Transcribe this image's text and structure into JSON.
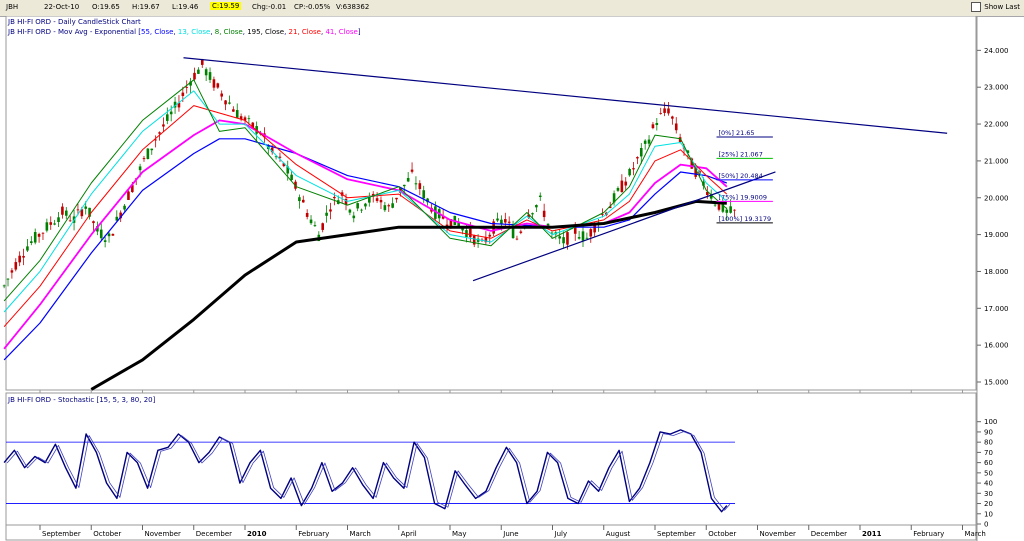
{
  "toolbar": {
    "symbol": "JBH",
    "date": "22-Oct-10",
    "open": "O:19.65",
    "high": "H:19.67",
    "low": "L:19.46",
    "close": "C:19.59",
    "change": "Chg:-0.01",
    "change_pct": "CP:-0.05%",
    "volume": "V:638362",
    "show_last": "Show Last"
  },
  "colors": {
    "ema55": "#0000ff",
    "ema13": "#00e0e0",
    "ema8": "#008000",
    "ema195": "#000000",
    "ema21": "#ff0000",
    "ema41": "#ff00ff",
    "trendline": "#000080",
    "fib_0": "#000080",
    "fib_25": "#00c000",
    "fib_50": "#0000ff",
    "fib_75": "#ff00ff",
    "fib_100": "#000000",
    "stoch": "#000080",
    "up_candle": "#008000",
    "down_candle": "#c00000"
  },
  "chart_data": [
    {
      "type": "line",
      "title": "JB HI-FI ORD - Daily CandleStick Chart",
      "subtitle_parts": [
        {
          "text": "JB HI-FI ORD - Mov Avg - Exponential [",
          "color": "#000080"
        },
        {
          "text": "55, Close",
          "color": "#0000ff"
        },
        {
          "text": ", ",
          "color": "#000080"
        },
        {
          "text": "13, Close",
          "color": "#00e0e0"
        },
        {
          "text": ", ",
          "color": "#000080"
        },
        {
          "text": "8, Close",
          "color": "#008000"
        },
        {
          "text": ", ",
          "color": "#000080"
        },
        {
          "text": "195, Close",
          "color": "#000000"
        },
        {
          "text": ", ",
          "color": "#000080"
        },
        {
          "text": "21, Close",
          "color": "#ff0000"
        },
        {
          "text": ", ",
          "color": "#000080"
        },
        {
          "text": "41, Close",
          "color": "#ff00ff"
        },
        {
          "text": "]",
          "color": "#000080"
        }
      ],
      "x_tick_labels": [
        "September",
        "October",
        "November",
        "December",
        "2010",
        "February",
        "March",
        "April",
        "May",
        "June",
        "July",
        "August",
        "September",
        "October",
        "November",
        "December",
        "2011",
        "February",
        "March"
      ],
      "x_ticks": [
        0,
        1,
        2,
        3,
        4,
        5,
        6,
        7,
        8,
        9,
        10,
        11,
        12,
        13,
        14,
        15,
        16,
        17,
        18
      ],
      "ylim": [
        14.8,
        24.3
      ],
      "y_ticks": [
        15.0,
        16.0,
        17.0,
        18.0,
        19.0,
        20.0,
        21.0,
        22.0,
        23.0,
        24.0
      ],
      "y_tick_labels": [
        "15.000",
        "16.000",
        "17.000",
        "18.000",
        "19.000",
        "20.000",
        "21.000",
        "22.000",
        "23.000",
        "24.000"
      ],
      "candles": {
        "x_start": -0.7,
        "x_end": 13.4,
        "close": [
          17.6,
          18.2,
          18.7,
          19.0,
          19.3,
          19.6,
          19.4,
          19.8,
          19.1,
          18.9,
          19.6,
          20.3,
          21.0,
          21.6,
          22.1,
          22.6,
          23.2,
          23.6,
          23.1,
          22.7,
          22.3,
          22.0,
          21.8,
          21.2,
          20.9,
          20.3,
          19.6,
          19.0,
          19.8,
          20.1,
          19.6,
          19.9,
          20.0,
          19.7,
          20.2,
          20.6,
          20.1,
          19.6,
          19.4,
          19.3,
          19.0,
          18.7,
          19.2,
          19.4,
          18.9,
          19.6,
          19.9,
          19.0,
          18.8,
          19.1,
          18.9,
          19.4,
          19.8,
          20.3,
          20.8,
          21.4,
          22.1,
          22.4,
          21.6,
          20.9,
          20.4,
          19.9,
          19.6
        ],
        "volatility": 0.35
      },
      "series": [
        {
          "name": "55, Close",
          "color": "#0000ff",
          "width": 1.2,
          "x": [
            -0.7,
            0,
            1,
            2,
            3,
            3.5,
            4,
            5,
            6,
            7,
            8,
            8.8,
            9.5,
            10,
            11,
            11.5,
            12,
            12.5,
            13,
            13.4
          ],
          "values": [
            15.6,
            16.6,
            18.5,
            20.2,
            21.2,
            21.6,
            21.6,
            21.2,
            20.6,
            20.3,
            19.6,
            19.3,
            19.25,
            19.2,
            19.2,
            19.4,
            20.1,
            20.7,
            20.6,
            20.4
          ]
        },
        {
          "name": "41, Close",
          "color": "#ff00ff",
          "width": 1.8,
          "x": [
            -0.7,
            0,
            1,
            2,
            3,
            3.5,
            4,
            5,
            6,
            7,
            8,
            8.8,
            9.5,
            10,
            11,
            11.5,
            12,
            12.5,
            13,
            13.4
          ],
          "values": [
            15.9,
            17.1,
            19.0,
            20.7,
            21.7,
            22.1,
            22.0,
            21.2,
            20.5,
            20.2,
            19.4,
            19.1,
            19.3,
            19.2,
            19.3,
            19.6,
            20.4,
            20.9,
            20.8,
            20.3
          ]
        },
        {
          "name": "21, Close",
          "color": "#ff0000",
          "width": 1.0,
          "x": [
            -0.7,
            0,
            1,
            2,
            3,
            3.5,
            4,
            5,
            6,
            7,
            8,
            8.8,
            9.5,
            10,
            11,
            11.5,
            12,
            12.5,
            13,
            13.4
          ],
          "values": [
            16.5,
            17.6,
            19.6,
            21.3,
            22.5,
            22.3,
            22.1,
            20.9,
            20.0,
            20.1,
            19.1,
            18.9,
            19.4,
            19.1,
            19.4,
            19.9,
            21.0,
            21.3,
            20.6,
            20.1
          ]
        },
        {
          "name": "13, Close",
          "color": "#00e0e0",
          "width": 1.0,
          "x": [
            -0.7,
            0,
            1,
            2,
            3,
            3.5,
            4,
            5,
            6,
            7,
            8,
            8.8,
            9.5,
            10,
            11,
            11.5,
            12,
            12.5,
            13,
            13.4
          ],
          "values": [
            16.9,
            18.0,
            20.1,
            21.8,
            22.9,
            22.0,
            22.0,
            20.6,
            19.9,
            20.2,
            19.0,
            18.8,
            19.5,
            19.0,
            19.5,
            20.1,
            21.4,
            21.5,
            20.4,
            19.9
          ]
        },
        {
          "name": "8, Close",
          "color": "#008000",
          "width": 1.0,
          "x": [
            -0.7,
            0,
            1,
            2,
            3,
            3.5,
            4,
            5,
            6,
            7,
            8,
            8.8,
            9.5,
            10,
            11,
            11.5,
            12,
            12.5,
            13,
            13.4
          ],
          "values": [
            17.2,
            18.3,
            20.4,
            22.1,
            23.2,
            21.8,
            21.9,
            20.3,
            19.8,
            20.3,
            18.9,
            18.7,
            19.6,
            18.9,
            19.6,
            20.3,
            21.7,
            21.6,
            20.2,
            19.7
          ]
        },
        {
          "name": "195, Close",
          "color": "#000000",
          "width": 3.0,
          "x": [
            1.0,
            2,
            3,
            4,
            5,
            6,
            7,
            8,
            9,
            10,
            11,
            12,
            12.8,
            13.4
          ],
          "values": [
            14.8,
            15.6,
            16.7,
            17.9,
            18.8,
            19.0,
            19.2,
            19.2,
            19.2,
            19.2,
            19.3,
            19.6,
            19.9,
            19.85
          ]
        }
      ],
      "trendlines": [
        {
          "x": [
            2.8,
            17.7
          ],
          "values": [
            23.8,
            21.75
          ],
          "color": "#000080"
        },
        {
          "x": [
            8.45,
            14.35
          ],
          "values": [
            17.75,
            20.7
          ],
          "color": "#000080"
        }
      ],
      "fib_levels": [
        {
          "label": "[0%] 21.65",
          "value": 21.65,
          "x": [
            13.2,
            14.3
          ],
          "color": "#000080"
        },
        {
          "label": "[25%] 21.067",
          "value": 21.067,
          "x": [
            13.2,
            14.3
          ],
          "color": "#00c000"
        },
        {
          "label": "[50%] 20.484",
          "value": 20.484,
          "x": [
            13.2,
            14.3
          ],
          "color": "#0000ff"
        },
        {
          "label": "[75%] 19.9009",
          "value": 19.9009,
          "x": [
            13.2,
            14.3
          ],
          "color": "#ff00ff"
        },
        {
          "label": "[100%] 19.3179",
          "value": 19.3179,
          "x": [
            13.2,
            14.3
          ],
          "color": "#000000"
        }
      ]
    },
    {
      "type": "line",
      "title": "JB HI-FI ORD - Stochastic [15, 5, 3, 80, 20]",
      "ylim": [
        0,
        100
      ],
      "y_ticks": [
        0,
        10,
        20,
        30,
        40,
        50,
        60,
        70,
        80,
        90,
        100
      ],
      "y_tick_labels": [
        "0",
        "10",
        "20",
        "30",
        "40",
        "50",
        "60",
        "70",
        "80",
        "90",
        "100"
      ],
      "reference_lines": [
        80,
        20
      ],
      "series": [
        {
          "name": "%K",
          "color": "#000080",
          "x": [
            -0.7,
            -0.5,
            -0.3,
            -0.1,
            0.1,
            0.3,
            0.5,
            0.7,
            0.9,
            1.1,
            1.3,
            1.5,
            1.7,
            1.9,
            2.1,
            2.3,
            2.5,
            2.7,
            2.9,
            3.1,
            3.3,
            3.5,
            3.7,
            3.9,
            4.1,
            4.3,
            4.5,
            4.7,
            4.9,
            5.1,
            5.3,
            5.5,
            5.7,
            5.9,
            6.1,
            6.3,
            6.5,
            6.7,
            6.9,
            7.1,
            7.3,
            7.5,
            7.7,
            7.9,
            8.1,
            8.3,
            8.5,
            8.7,
            8.9,
            9.1,
            9.3,
            9.5,
            9.7,
            9.9,
            10.1,
            10.3,
            10.5,
            10.7,
            10.9,
            11.1,
            11.3,
            11.5,
            11.7,
            11.9,
            12.1,
            12.3,
            12.5,
            12.7,
            12.9,
            13.1,
            13.3,
            13.4
          ],
          "values": [
            60,
            72,
            55,
            66,
            60,
            78,
            55,
            35,
            88,
            70,
            40,
            25,
            70,
            60,
            35,
            72,
            75,
            88,
            80,
            60,
            70,
            85,
            80,
            40,
            60,
            72,
            35,
            25,
            45,
            18,
            35,
            60,
            32,
            40,
            55,
            38,
            25,
            60,
            45,
            35,
            80,
            65,
            20,
            15,
            52,
            38,
            25,
            32,
            55,
            75,
            60,
            20,
            32,
            70,
            60,
            25,
            20,
            42,
            32,
            55,
            72,
            22,
            35,
            60,
            90,
            88,
            92,
            88,
            70,
            25,
            12,
            18
          ]
        }
      ]
    }
  ]
}
